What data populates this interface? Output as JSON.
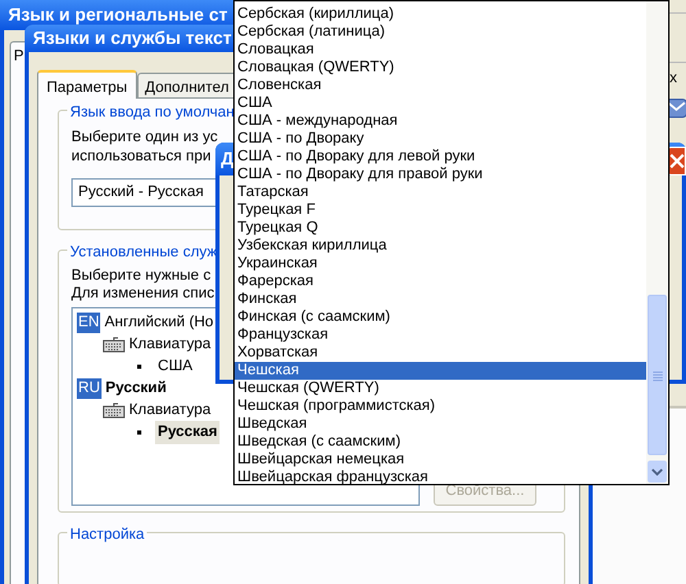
{
  "outer_window": {
    "title": "Язык и региональные ст",
    "tab": "Р"
  },
  "side_window": {
    "text": "х"
  },
  "dialog": {
    "title": "Языки и службы текст",
    "tabs": [
      {
        "label": "Параметры",
        "selected": true
      },
      {
        "label": "Дополнител",
        "selected": false
      }
    ],
    "default_language": {
      "heading": "Язык ввода по умолчан",
      "lines": [
        "Выберите один из ус",
        "использоваться при"
      ],
      "value": "Русский - Русская"
    },
    "installed": {
      "heading": "Установленные служ",
      "lines": [
        "Выберите нужные с",
        "Для изменения спис"
      ],
      "tree": [
        {
          "badge": "EN",
          "label": "Английский (Но",
          "default": false,
          "children": [
            {
              "label": "Клавиатура",
              "children": [
                {
                  "label": "США",
                  "default": false,
                  "selected": false
                }
              ]
            }
          ]
        },
        {
          "badge": "RU",
          "label": "Русский",
          "default": true,
          "children": [
            {
              "label": "Клавиатура",
              "children": [
                {
                  "label": "Русская",
                  "default": true,
                  "selected": true
                }
              ]
            }
          ]
        }
      ],
      "button": {
        "label": "Свойства...",
        "disabled": true
      }
    },
    "settings": {
      "heading": "Настройка"
    }
  },
  "back_dialog": {
    "title": "Д"
  },
  "dropdown": {
    "items": [
      {
        "label": "Сербская (кириллица)",
        "selected": false
      },
      {
        "label": "Сербская (латиница)",
        "selected": false
      },
      {
        "label": "Словацкая",
        "selected": false
      },
      {
        "label": "Словацкая (QWERTY)",
        "selected": false
      },
      {
        "label": "Словенская",
        "selected": false
      },
      {
        "label": "США",
        "selected": false
      },
      {
        "label": "США - международная",
        "selected": false
      },
      {
        "label": "США - по Двораку",
        "selected": false
      },
      {
        "label": "США - по Двораку для левой руки",
        "selected": false
      },
      {
        "label": "США - по Двораку для правой руки",
        "selected": false
      },
      {
        "label": "Татарская",
        "selected": false
      },
      {
        "label": "Турецкая F",
        "selected": false
      },
      {
        "label": "Турецкая Q",
        "selected": false
      },
      {
        "label": "Узбекская кириллица",
        "selected": false
      },
      {
        "label": "Украинская",
        "selected": false
      },
      {
        "label": "Фарерская",
        "selected": false
      },
      {
        "label": "Финская",
        "selected": false
      },
      {
        "label": "Финская (с саамским)",
        "selected": false
      },
      {
        "label": "Французская",
        "selected": false
      },
      {
        "label": "Хорватская",
        "selected": false
      },
      {
        "label": "Чешская",
        "selected": true
      },
      {
        "label": "Чешская (QWERTY)",
        "selected": false
      },
      {
        "label": "Чешская (программистская)",
        "selected": false
      },
      {
        "label": "Шведская",
        "selected": false
      },
      {
        "label": "Шведская (с саамским)",
        "selected": false
      },
      {
        "label": "Швейцарская немецкая",
        "selected": false
      },
      {
        "label": "Швейцарская французская",
        "selected": false
      }
    ]
  }
}
